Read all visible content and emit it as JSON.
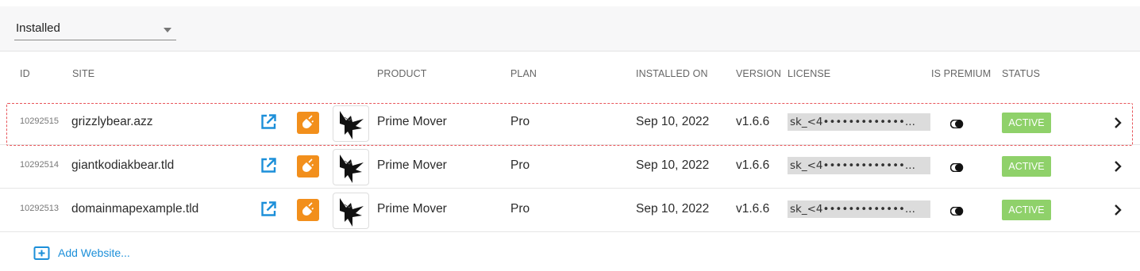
{
  "filter": {
    "selected": "Installed"
  },
  "columns": {
    "id": "ID",
    "site": "SITE",
    "product": "PRODUCT",
    "plan": "PLAN",
    "installed_on": "INSTALLED ON",
    "version": "VERSION",
    "license": "LICENSE",
    "is_premium": "IS PREMIUM",
    "status": "STATUS"
  },
  "rows": [
    {
      "id": "10292515",
      "site": "grizzlybear.azz",
      "product": "Prime Mover",
      "plan": "Pro",
      "installed_on": "Sep 10, 2022",
      "version": "v1.6.6",
      "license": "sk_<4•••••••••••••...",
      "is_premium": true,
      "status": "ACTIVE",
      "highlighted": true
    },
    {
      "id": "10292514",
      "site": "giantkodiakbear.tld",
      "product": "Prime Mover",
      "plan": "Pro",
      "installed_on": "Sep 10, 2022",
      "version": "v1.6.6",
      "license": "sk_<4•••••••••••••...",
      "is_premium": true,
      "status": "ACTIVE",
      "highlighted": false
    },
    {
      "id": "10292513",
      "site": "domainmapexample.tld",
      "product": "Prime Mover",
      "plan": "Pro",
      "installed_on": "Sep 10, 2022",
      "version": "v1.6.6",
      "license": "sk_<4•••••••••••••...",
      "is_premium": true,
      "status": "ACTIVE",
      "highlighted": false
    }
  ],
  "add_website": {
    "label": "Add Website..."
  },
  "icons": {
    "external": "external-link-icon",
    "plugin": "plugin-icon",
    "product_logo": "prime-mover-logo",
    "premium": "toggle-icon",
    "open": "chevron-right-icon",
    "add": "add-square-icon"
  },
  "colors": {
    "accent": "#1c8fd9",
    "plugin_bg": "#f28f1c",
    "status_active": "#8fd16a",
    "highlight": "#e8555a"
  }
}
